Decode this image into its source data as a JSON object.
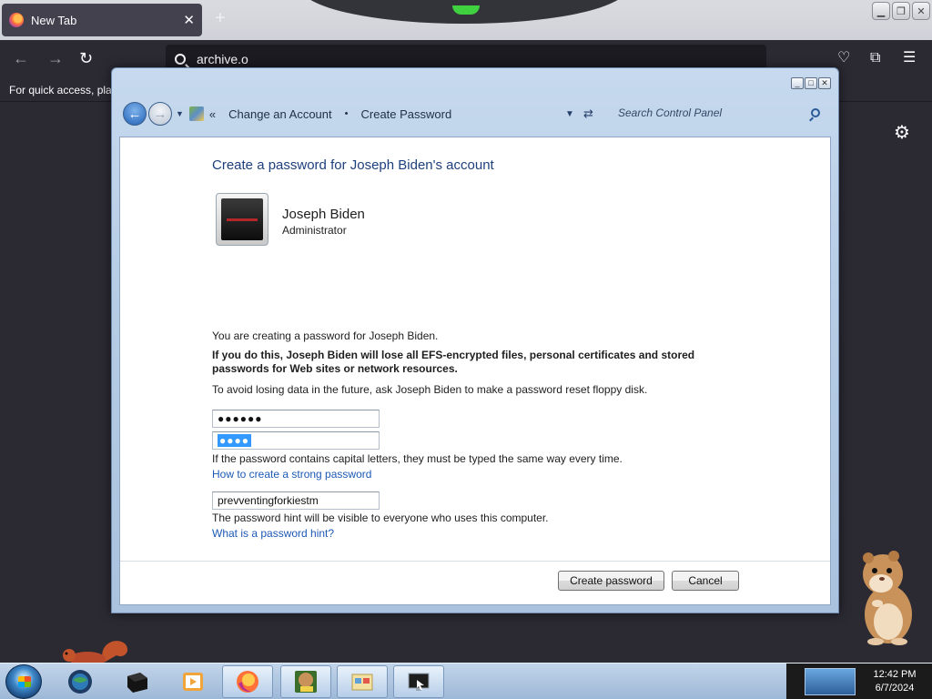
{
  "browser": {
    "tab_title": "New Tab",
    "tab_close": "✕",
    "new_tab": "+",
    "url_value": "archive.o",
    "bookmarks_hint": "For quick access, plac"
  },
  "window": {
    "breadcrumb": [
      "Change an Account",
      "Create Password"
    ],
    "breadcrumb_separator": "•",
    "crumb_prefix": "«",
    "search_placeholder": "Search Control Panel",
    "heading": "Create a password for Joseph Biden's account",
    "user_name": "Joseph Biden",
    "user_role": "Administrator",
    "info_text": "You are creating a password for Joseph Biden.",
    "warning_text": "If you do this, Joseph Biden will lose all EFS-encrypted files, personal certificates and stored passwords for Web sites or network resources.",
    "advice_text": "To avoid losing data in the future, ask Joseph Biden to make a password reset floppy disk.",
    "new_password_masked": "●●●●●●",
    "confirm_password_masked": "●●●●",
    "caps_note": "If the password contains capital letters, they must be typed the same way every time.",
    "strong_password_link": "How to create a strong password",
    "hint_value": "prevventingforkiestm",
    "hint_note": "The password hint will be visible to everyone who uses this computer.",
    "hint_link": "What is a password hint?",
    "create_button": "Create password",
    "cancel_button": "Cancel"
  },
  "taskbar": {
    "clock_time": "12:42 PM",
    "clock_date": "6/7/2024"
  }
}
